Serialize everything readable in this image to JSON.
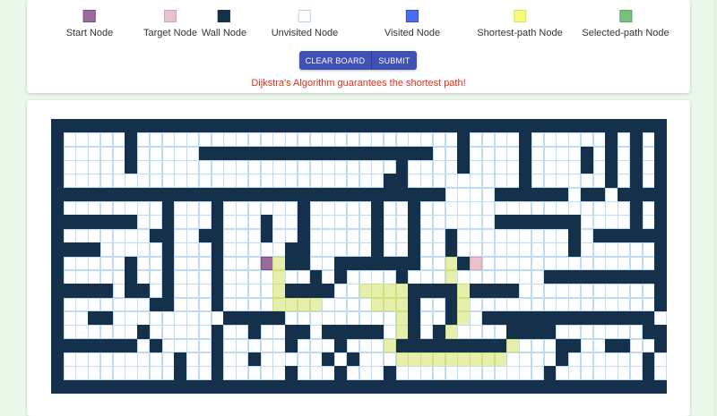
{
  "legend": [
    {
      "label": "Start Node",
      "color": "#9b6b9c",
      "border": "#7a4f7b"
    },
    {
      "label": "Target Node",
      "color": "#e8c1cb",
      "border": "#d4a4b0"
    },
    {
      "label": "Wall Node",
      "color": "#15304a",
      "border": "#15304a"
    },
    {
      "label": "Unvisited Node",
      "color": "#ffffff",
      "border": "#b7d3ef"
    },
    {
      "label": "Visited Node",
      "color": "#4a6df0",
      "border": "#3450c8"
    },
    {
      "label": "Shortest-path Node",
      "color": "#f7f97a",
      "border": "#e0e25a"
    },
    {
      "label": "Selected-path Node",
      "color": "#79c07f",
      "border": "#5ea464"
    }
  ],
  "buttons": {
    "clear": "CLEAR BOARD",
    "submit": "SUBMIT"
  },
  "message": "Dijkstra's Algorithm guarantees the shortest path!",
  "colors": {
    "wall": "#15304a",
    "path": "#e6efac",
    "grid_line": "#bfdcf5",
    "message": "#e02f1b",
    "button": "#3f51b5"
  },
  "grid": {
    "rows": [
      "##################################################",
      "#.....#..........................#....#......#.#.#",
      "#.....#.....###################..#....#....#.#.#.#",
      "#.....#.....................#....#....#....#.#.#.#",
      "#..........................##.........#......#.#.#",
      "################################....######.##.####",
      "#........#...#......#.....#..#.................#.#",
      "#######..#...#...#..#.....#..#......#######....#.#",
      "#.......##..##...#..#.....#..#..#.........#.######",
      "####.....#...#.....##.....#..#..#.........#......#",
      "#.....#..#...#...SP##..#######..P#S..............#",
      "#.....#..#...#....P..#.#....#...P.......##########",
      "#####.##.#...#....P####..PPPP####P####...........#",
      "#.......##...#....PPPP....PPP#..#P...............#",
      "#..##.........#####.........P#..#P.##############.",
      "#......#.....#..#..##.#####.P#.#P....####.......##",
      "#######.#....#.....#...#...P#########P...##..##..#",
      "#.........#..#..#.....#.#...PPPPPPPPP....#......#",
      "#.........#..#.....#...#...#............#.......#",
      "##################################################"
    ]
  }
}
